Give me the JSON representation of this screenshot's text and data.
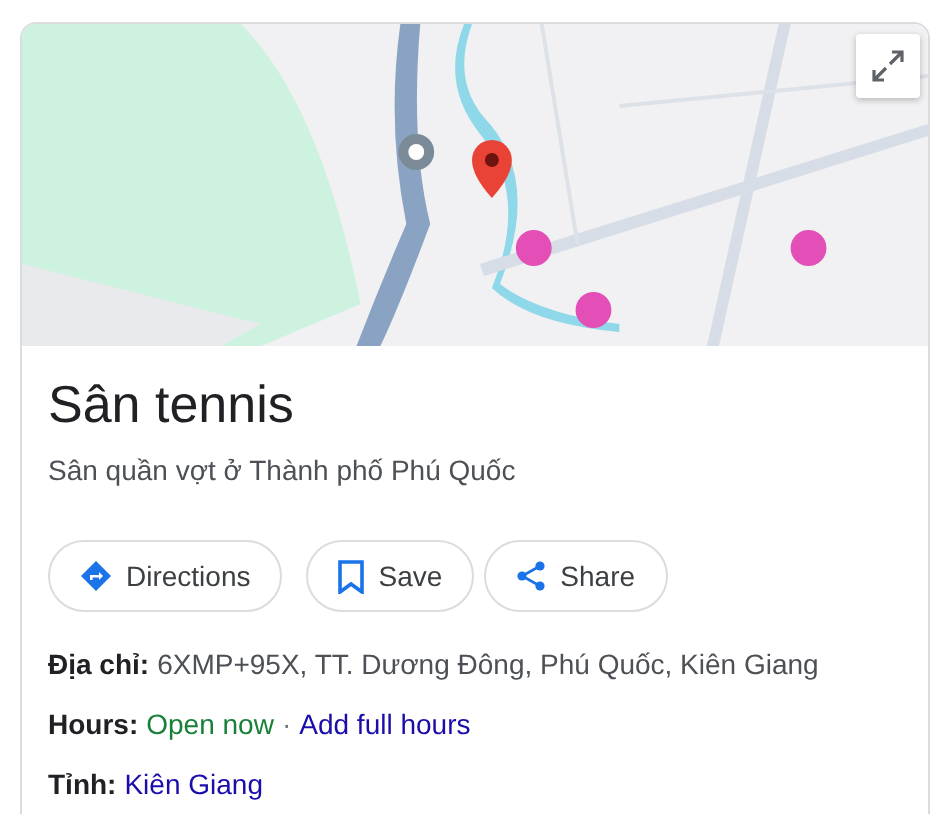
{
  "place": {
    "title": "Sân tennis",
    "subtitle": "Sân quần vợt ở Thành phố Phú Quốc"
  },
  "actions": [
    {
      "label": "Directions",
      "kind": "directions"
    },
    {
      "label": "Save",
      "kind": "save"
    },
    {
      "label": "Share",
      "kind": "share"
    }
  ],
  "details": [
    {
      "label": "Địa chỉ:",
      "parts": [
        {
          "text": "6XMP+95X, TT. Dương Đông, Phú Quốc, Kiên Giang",
          "kind": "plain"
        }
      ]
    },
    {
      "label": "Hours:",
      "parts": [
        {
          "text": "Open now",
          "kind": "status"
        },
        {
          "text": "·",
          "kind": "separator"
        },
        {
          "text": "Add full hours",
          "kind": "link"
        }
      ]
    },
    {
      "label": "Tỉnh:",
      "parts": [
        {
          "text": "Kiên Giang",
          "kind": "link"
        }
      ]
    }
  ]
}
